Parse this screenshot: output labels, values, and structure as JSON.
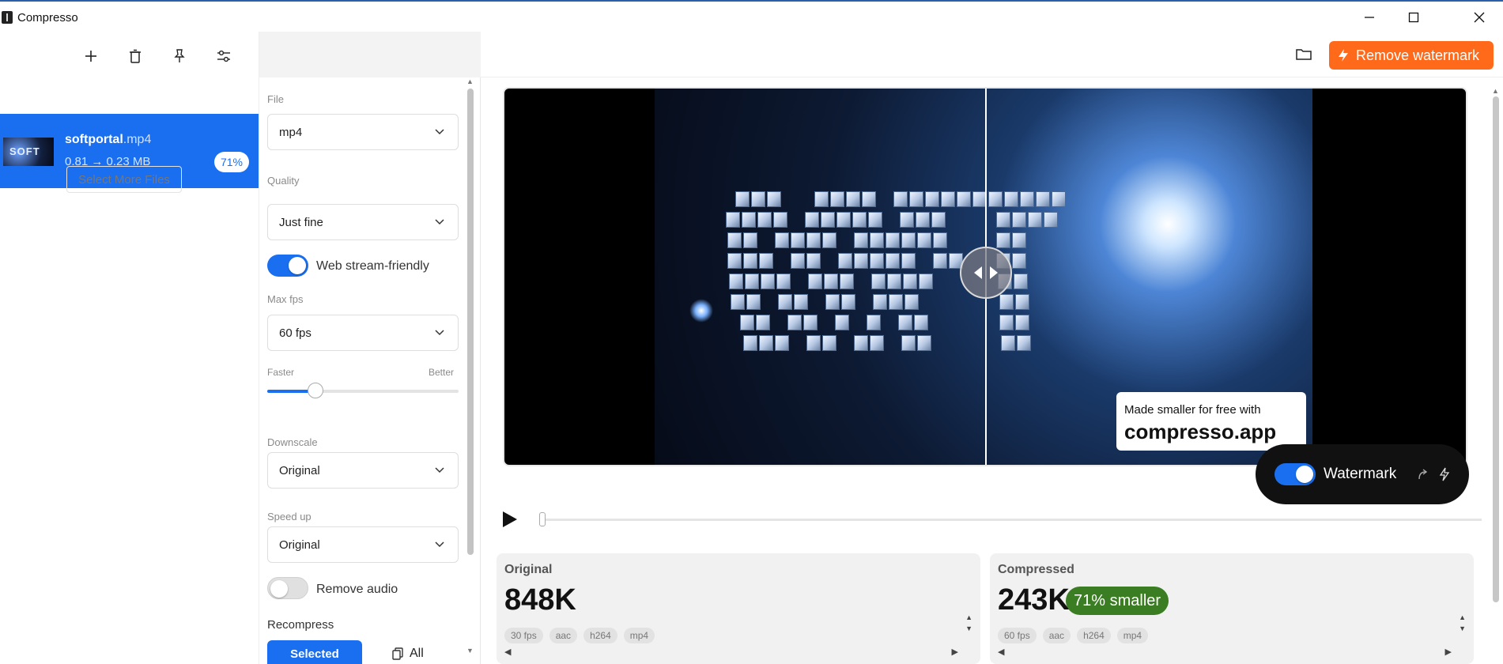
{
  "window": {
    "title": "Compresso",
    "controls": [
      "minimize",
      "maximize",
      "close"
    ]
  },
  "toolbar": {
    "icons": [
      "add-icon",
      "trash-icon",
      "pin-icon",
      "sliders-icon"
    ]
  },
  "file_list": {
    "items": [
      {
        "name": "softportal",
        "ext": ".mp4",
        "size": "0.81 → 0.23 MB",
        "badge": "71%",
        "thumb_text": "SOFT"
      }
    ],
    "select_more": "Select More Files"
  },
  "settings": {
    "file_label": "File",
    "file_value": "mp4",
    "quality_label": "Quality",
    "quality_value": "Just fine",
    "web_stream": {
      "label": "Web stream-friendly",
      "on": true
    },
    "max_fps_label": "Max fps",
    "max_fps_value": "60 fps",
    "slider": {
      "left_label": "Faster",
      "right_label": "Better",
      "fraction": 0.25
    },
    "downscale_label": "Downscale",
    "downscale_value": "Original",
    "speed_label": "Speed up",
    "speed_value": "Original",
    "remove_audio": {
      "label": "Remove audio",
      "on": false
    },
    "recompress_label": "Recompress",
    "selected_label": "Selected",
    "all_label": "All"
  },
  "preview": {
    "remove_watermark_label": "Remove watermark",
    "watermark_small": "Made smaller for free with",
    "watermark_big": "compresso.app",
    "watermark_toggle_label": "Watermark",
    "watermark_on": true,
    "playback_progress": 0.0
  },
  "stats": {
    "original": {
      "title": "Original",
      "value": "848K",
      "tags": [
        "30 fps",
        "aac",
        "h264",
        "mp4"
      ]
    },
    "compressed": {
      "title": "Compressed",
      "value": "243K",
      "badge": "71% smaller",
      "tags": [
        "60 fps",
        "aac",
        "h264",
        "mp4"
      ]
    }
  },
  "colors": {
    "accent": "#1a6ff0",
    "warning": "#ff6a1a",
    "success": "#3b7d22"
  }
}
